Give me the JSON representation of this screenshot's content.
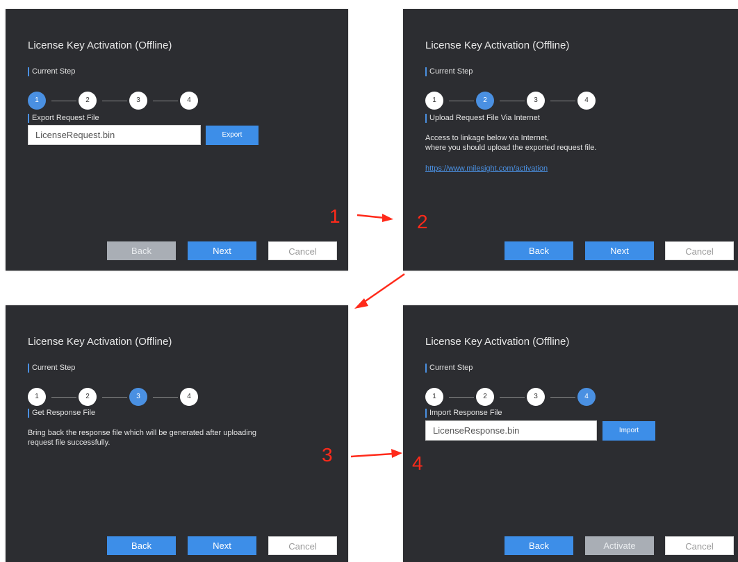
{
  "dialog_title": "License Key Activation (Offline)",
  "current_step_label": "Current Step",
  "step_numbers": [
    "1",
    "2",
    "3",
    "4"
  ],
  "panel1": {
    "section_label": "Export Request File",
    "file_value": "LicenseRequest.bin",
    "action_label": "Export",
    "back_label": "Back",
    "next_label": "Next",
    "cancel_label": "Cancel",
    "active_step": 1
  },
  "panel2": {
    "section_label": "Upload Request File Via Internet",
    "line1": "Access to linkage below via Internet,",
    "line2": "where you should upload the exported request file.",
    "link": "https://www.milesight.com/activation",
    "back_label": "Back",
    "next_label": "Next",
    "cancel_label": "Cancel",
    "active_step": 2
  },
  "panel3": {
    "section_label": "Get Response File",
    "line1": "Bring back the response file which will be generated after uploading",
    "line2": "request file successfully.",
    "back_label": "Back",
    "next_label": "Next",
    "cancel_label": "Cancel",
    "active_step": 3
  },
  "panel4": {
    "section_label": "Import Response File",
    "file_value": "LicenseResponse.bin",
    "action_label": "Import",
    "back_label": "Back",
    "activate_label": "Activate",
    "cancel_label": "Cancel",
    "active_step": 4
  },
  "markers": [
    "1",
    "2",
    "3",
    "4"
  ],
  "colors": {
    "dialog_bg": "#2c2d31",
    "accent": "#3d8ee8",
    "disabled": "#a9aeb5",
    "marker": "#ff2a1a"
  }
}
